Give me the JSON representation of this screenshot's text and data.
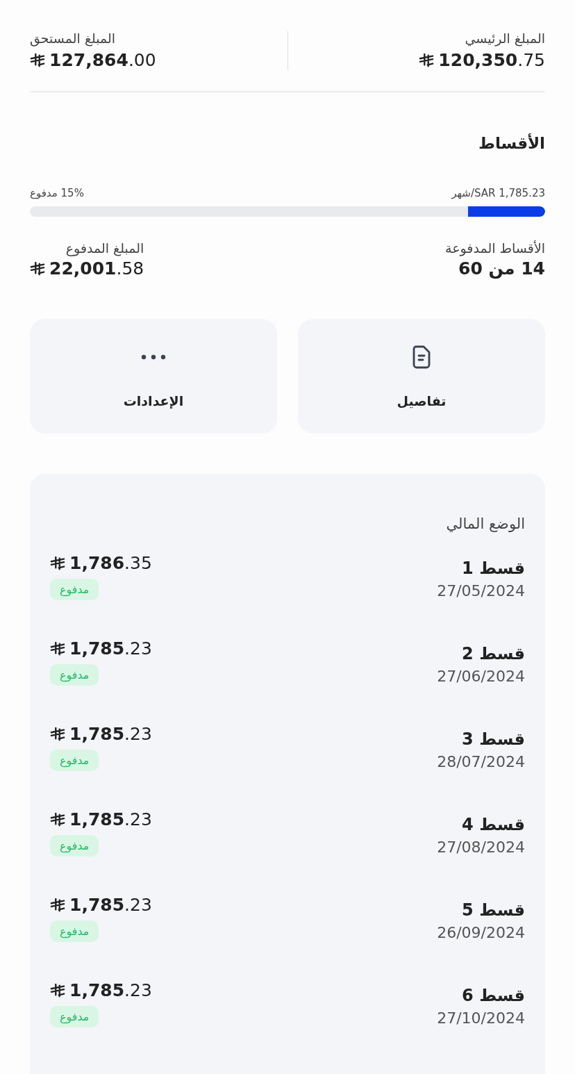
{
  "summary": [
    {
      "label": "المبلغ الرئيسي",
      "amount": "**120,350**.75"
    },
    {
      "label": "المبلغ المستحق",
      "amount": "**127,864**.00"
    }
  ],
  "installments": {
    "title": "الأقساط",
    "monthly": "شهر/SAR 1,785.23",
    "paid_percent": "15% مدفوع",
    "level": 0.15,
    "stats": [
      {
        "label": "الأقساط المدفوعة",
        "value": "14 من 60",
        "kind": "count"
      },
      {
        "label": "المبلغ المدفوع",
        "value": "**22,001**.58",
        "kind": "money"
      }
    ]
  },
  "actions": [
    {
      "label": "تفاصيل",
      "kind": "details"
    },
    {
      "label": "الإعدادات",
      "kind": "settings"
    }
  ],
  "financial_status": {
    "title": "الوضع المالي",
    "rows": [
      {
        "name": "قسط 1",
        "date": "27/05/2024",
        "amount": "**1,786**.35",
        "status": {
          "label": "مدفوع",
          "kind": "paid"
        }
      },
      {
        "name": "قسط 2",
        "date": "27/06/2024",
        "amount": "**1,785**.23",
        "status": {
          "label": "مدفوع",
          "kind": "paid"
        }
      },
      {
        "name": "قسط 3",
        "date": "28/07/2024",
        "amount": "**1,785**.23",
        "status": {
          "label": "مدفوع",
          "kind": "paid"
        }
      },
      {
        "name": "قسط 4",
        "date": "27/08/2024",
        "amount": "**1,785**.23",
        "status": {
          "label": "مدفوع",
          "kind": "paid"
        }
      },
      {
        "name": "قسط 5",
        "date": "26/09/2024",
        "amount": "**1,785**.23",
        "status": {
          "label": "مدفوع",
          "kind": "paid"
        }
      },
      {
        "name": "قسط 6",
        "date": "27/10/2024",
        "amount": "**1,785**.23",
        "status": {
          "label": "مدفوع",
          "kind": "paid"
        }
      }
    ]
  }
}
